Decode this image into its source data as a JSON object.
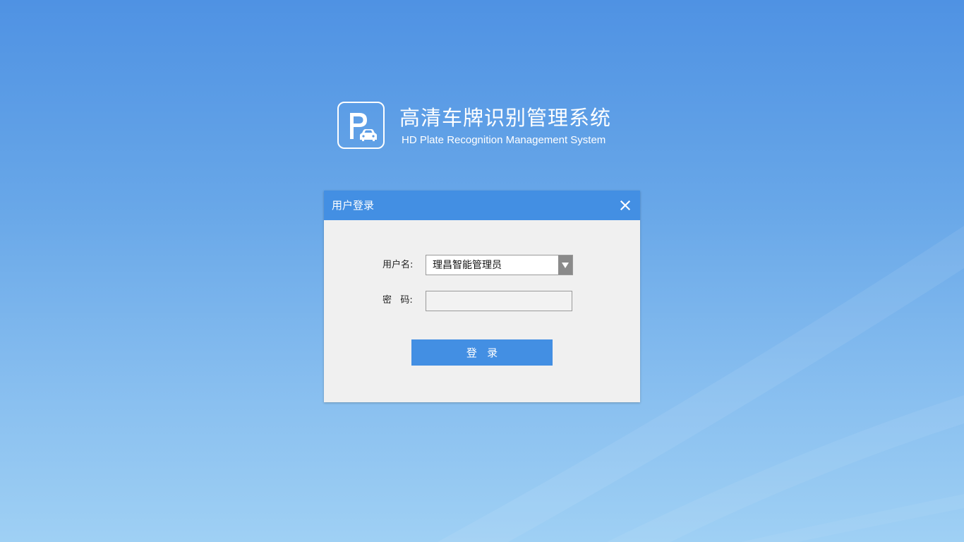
{
  "brand": {
    "logo_icon": "parking-car-icon",
    "title": "高清车牌识别管理系统",
    "subtitle": "HD Plate Recognition Management System"
  },
  "dialog": {
    "title": "用户登录",
    "close_icon": "close-icon",
    "username_label": "用户名:",
    "username_value": "理昌智能管理员",
    "password_label": "密   码:",
    "password_value": "",
    "login_label": "登   录"
  },
  "colors": {
    "accent": "#438fe3",
    "dialog_bg": "#f0f0f0",
    "bg_top": "#4f92e3",
    "bg_bottom": "#9fd0f4"
  }
}
